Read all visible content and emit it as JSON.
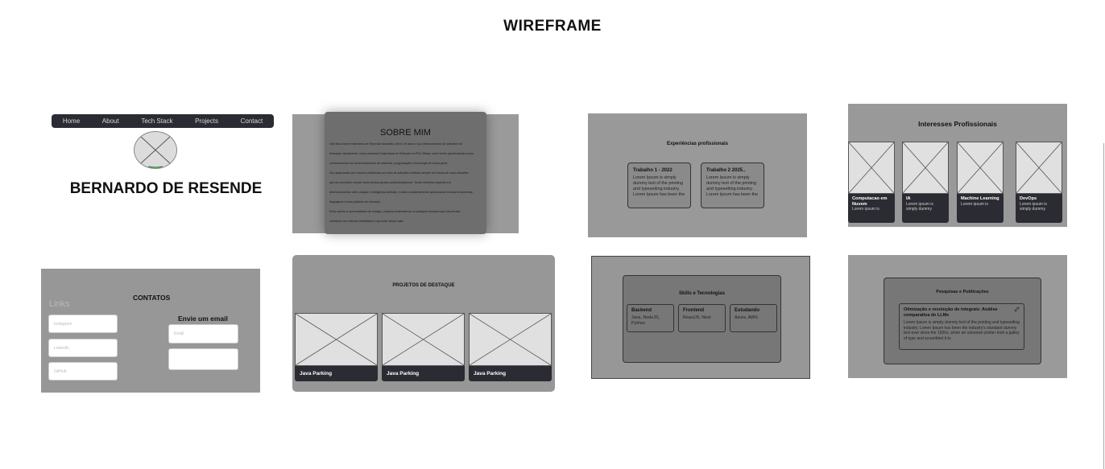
{
  "page": {
    "title": "WIREFRAME"
  },
  "home": {
    "nav": [
      "Home",
      "About",
      "Tech Stack",
      "Projects",
      "Contact"
    ],
    "name": "BERNARDO DE RESENDE"
  },
  "about": {
    "title": "SOBRE MIM",
    "lines": [
      "Olá! Meu nome é Bernardo de Resende Marcelino, tenho 19 anos e sou desenvolvedor de software em",
      "formação. Atualmente, estou cursando Engenharia de Software na PUC Minas, onde venho aprofundando meus",
      "conhecimentos em desenvolvimento de sistemas, programação e tecnologia de forma geral.",
      "Sou apaixonado por resolver problemas por meio de soluções criativas sempre em busca de novos desafios",
      "que me permitam crescer tanto técnica quanto profissionalmente. Tenho interesse especial em",
      "desenvolvimento web, criação e inteligência artificial, e estou constantemente aprimorando minhas ferramentas,",
      "linguagens e boas práticas do mercado.",
      "Estou aberto a oportunidades de estágio, projetos colaborativos ou qualquer iniciativa que me permita",
      "contribuir com minhas habilidades e aprender ainda mais!"
    ]
  },
  "experience": {
    "title": "Experiências profissionais",
    "jobs": [
      {
        "title": "Trabalho 1 - 2022",
        "desc": "Lorem Ipsum is simply dummy text of the printing and typesetting industry. Lorem Ipsum has been the industry's standard"
      },
      {
        "title": "Trabalho 2 2025..",
        "desc": "Lorem Ipsum is simply dummy text of the printing and typesetting industry. Lorem Ipsum has been the"
      }
    ]
  },
  "interests": {
    "title": "Interesses Profissionais",
    "cards": [
      {
        "title": "Computacao em Nuvem",
        "desc": "Lorem ipsum is"
      },
      {
        "title": "IA",
        "desc": "Lorem ipsum is simply dummy"
      },
      {
        "title": "Machine Learning",
        "desc": "Lorem ipsum is"
      },
      {
        "title": "DevOps",
        "desc": "Lorem ipsum is simply dummy"
      }
    ]
  },
  "contacts": {
    "title": "CONTATOS",
    "links_label": "Links",
    "links": [
      "Instagram",
      "LinkedIn",
      "GitHub"
    ],
    "email_title": "Envie um email",
    "email_placeholder": "Email",
    "message_placeholder": ""
  },
  "projects": {
    "title": "PROJETOS DE DESTAQUE",
    "cards": [
      "Java Parking",
      "Java Parking",
      "Java Parking"
    ]
  },
  "skills": {
    "title": "Skills e Tecnologias",
    "groups": [
      {
        "title": "Backend",
        "items": "Java, NodeJS, Python"
      },
      {
        "title": "Frontend",
        "items": "ReactJS, Next"
      },
      {
        "title": "Estudando",
        "items": "Azure, AWS"
      }
    ]
  },
  "publications": {
    "title": "Pesquisas e Publicações",
    "item": {
      "title": "Otimização e resolução de integrais: Análise comparativa de LLMs",
      "desc": "Lorem Ipsum is simply dummy text of the printing and typesetting industry. Lorem Ipsum has been the industry's standard dummy text ever since the 1500s, when an unknown printer took a galley of type and scrambled it to"
    }
  }
}
